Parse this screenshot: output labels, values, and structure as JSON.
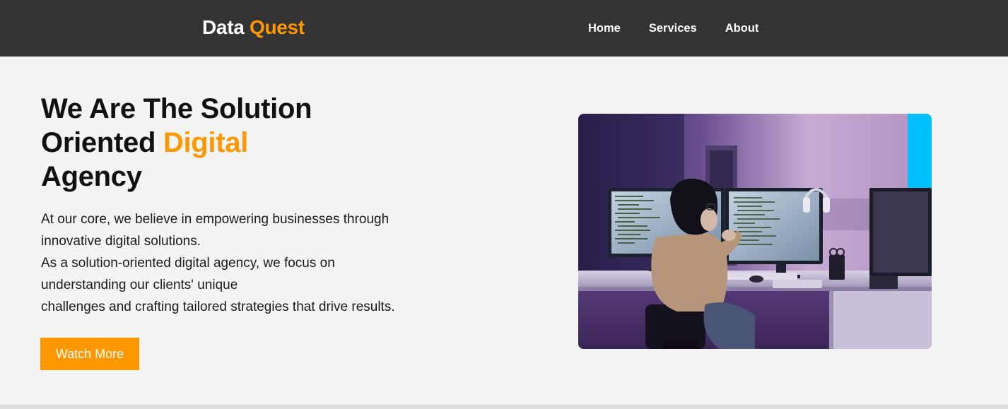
{
  "brand": {
    "part1": "Data",
    "part2": "Quest"
  },
  "nav": {
    "items": [
      {
        "label": "Home"
      },
      {
        "label": "Services"
      },
      {
        "label": "About"
      }
    ]
  },
  "hero": {
    "title_line1": "We Are The Solution",
    "title_line2a": "Oriented ",
    "title_line2b": "Digital",
    "title_line3": "Agency",
    "paragraph_lines": [
      "At our core, we believe in empowering businesses through",
      "innovative digital solutions.",
      "As a solution-oriented digital agency, we focus on",
      "understanding our clients' unique",
      "challenges and crafting tailored strategies that drive results."
    ],
    "button_label": "Watch More"
  },
  "colors": {
    "navbar_bg": "#333333",
    "accent": "#ff9800",
    "page_bg": "#f4f4f4"
  }
}
